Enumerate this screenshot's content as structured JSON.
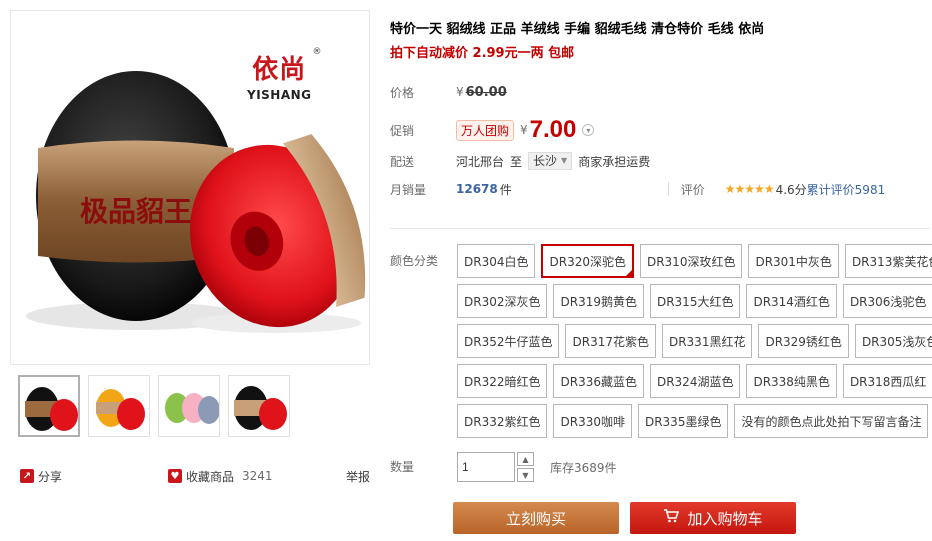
{
  "gallery": {
    "brand_cn": "依尚",
    "brand_reg": "®",
    "brand_en": "YISHANG",
    "thumbnails": [
      "thumb-1",
      "thumb-2",
      "thumb-3",
      "thumb-4"
    ],
    "share_label": "分享",
    "fav_label": "收藏商品",
    "fav_count": "3241",
    "report_label": "举报"
  },
  "product": {
    "title": "特价一天 貂绒线 正品 羊绒线 手编 貂绒毛线 清仓特价 毛线 依尚",
    "subtitle": "拍下自动减价 2.99元一两 包邮"
  },
  "price": {
    "label": "价格",
    "currency": "¥",
    "original": "60.00"
  },
  "promo": {
    "label": "促销",
    "badge": "万人团购",
    "currency": "¥",
    "value": "7.00"
  },
  "shipping": {
    "label": "配送",
    "from": "河北邢台",
    "to_word": "至",
    "dest": "长沙",
    "fee_text": "商家承担运费"
  },
  "sales": {
    "label": "月销量",
    "count": "12678",
    "unit": "件"
  },
  "rating": {
    "label": "评价",
    "stars": "★★★★★",
    "score_text": "4.6分",
    "reviews_text": "累计评价5981"
  },
  "colors": {
    "label": "颜色分类",
    "rows": [
      [
        "DR304白色",
        "DR320深驼色",
        "DR310深玫红色",
        "DR301中灰色",
        "DR313紫芙花色"
      ],
      [
        "DR302深灰色",
        "DR319鹅黄色",
        "DR315大红色",
        "DR314酒红色",
        "DR306浅驼色"
      ],
      [
        "DR352牛仔蓝色",
        "DR317花紫色",
        "DR331黑红花",
        "DR329锈红色",
        "DR305浅灰色"
      ],
      [
        "DR322暗红色",
        "DR336藏蓝色",
        "DR324湖蓝色",
        "DR338纯黑色",
        "DR318西瓜红"
      ],
      [
        "DR332紫红色",
        "DR330咖啡",
        "DR335墨绿色",
        "没有的颜色点此处拍下写留言备注"
      ]
    ],
    "selected": "DR320深驼色"
  },
  "quantity": {
    "label": "数量",
    "value": "1",
    "stock": "库存3689件"
  },
  "actions": {
    "buy_now": "立刻购买",
    "add_cart": "加入购物车"
  },
  "theme": {
    "accent": "#c40000",
    "link": "#3a64a5",
    "buy_btn": "#c8753a",
    "cart_btn": "#d42317"
  }
}
